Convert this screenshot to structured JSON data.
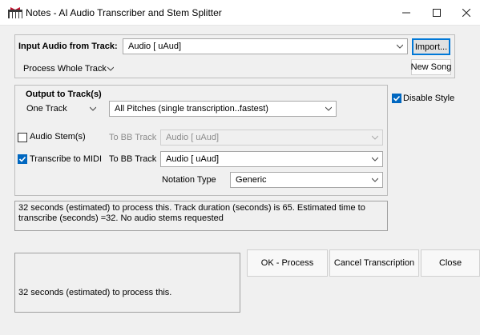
{
  "window": {
    "title": "Notes - AI Audio Transcriber and Stem Splitter"
  },
  "input": {
    "label": "Input Audio from Track:",
    "track_value": "Audio  [ uAud]",
    "process_value": "Process Whole Track",
    "import_label": "Import...",
    "new_song_label": "New Song"
  },
  "output": {
    "label": "Output to Track(s)",
    "tracks_value": "One Track",
    "pitches_value": "All Pitches (single transcription..fastest)",
    "audio_stems_label": "Audio Stem(s)",
    "audio_stems_checked": false,
    "to_bb_track_label_1": "To BB Track",
    "stem_track_value": "Audio  [ uAud]",
    "transcribe_midi_label": "Transcribe to MIDI",
    "transcribe_midi_checked": true,
    "to_bb_track_label_2": "To BB Track",
    "midi_track_value": "Audio  [ uAud]",
    "notation_type_label": "Notation Type",
    "notation_type_value": "Generic"
  },
  "disable_style": {
    "label": "Disable Style",
    "checked": true
  },
  "info_text": "32 seconds (estimated) to process this. Track duration (seconds) is 65. Estimated time to transcribe (seconds) =32. No audio stems requested",
  "status_text": "32 seconds (estimated) to process this.",
  "actions": {
    "ok_label": "OK - Process",
    "cancel_label": "Cancel Transcription",
    "close_label": "Close"
  },
  "colors": {
    "accent": "#0067c0",
    "dialog_bg": "#f0f0f0"
  }
}
